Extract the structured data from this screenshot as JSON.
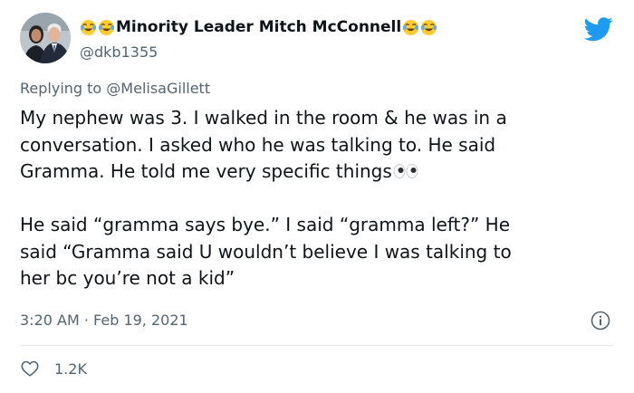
{
  "author": {
    "display_name": "Minority Leader Mitch McConnell",
    "leading_emoji": [
      "joy-emoji",
      "joy-emoji"
    ],
    "trailing_emoji": [
      "joy-emoji",
      "joy-emoji"
    ],
    "handle": "@dkb1355"
  },
  "reply": {
    "prefix": "Replying to",
    "mention": "@MelisaGillett"
  },
  "body": {
    "paragraph1": [
      "My nephew was 3. I walked in the room & he was in a",
      "conversation. I asked who he was talking to. He said",
      "Gramma. He told me very specific things"
    ],
    "paragraph1_emoji": "eyes-emoji",
    "paragraph2": [
      "He said “gramma says bye.” I said “gramma left?” He",
      "said “Gramma said U wouldn’t believe I was talking to",
      "her bc you’re not a kid”"
    ]
  },
  "meta": {
    "timestamp": "3:20 AM · Feb 19, 2021"
  },
  "stats": {
    "likes": "1.2K"
  },
  "colors": {
    "text": "#0f1419",
    "secondary": "#536471",
    "twitter_blue": "#1d9bf0",
    "divider": "#e2e6ea"
  }
}
